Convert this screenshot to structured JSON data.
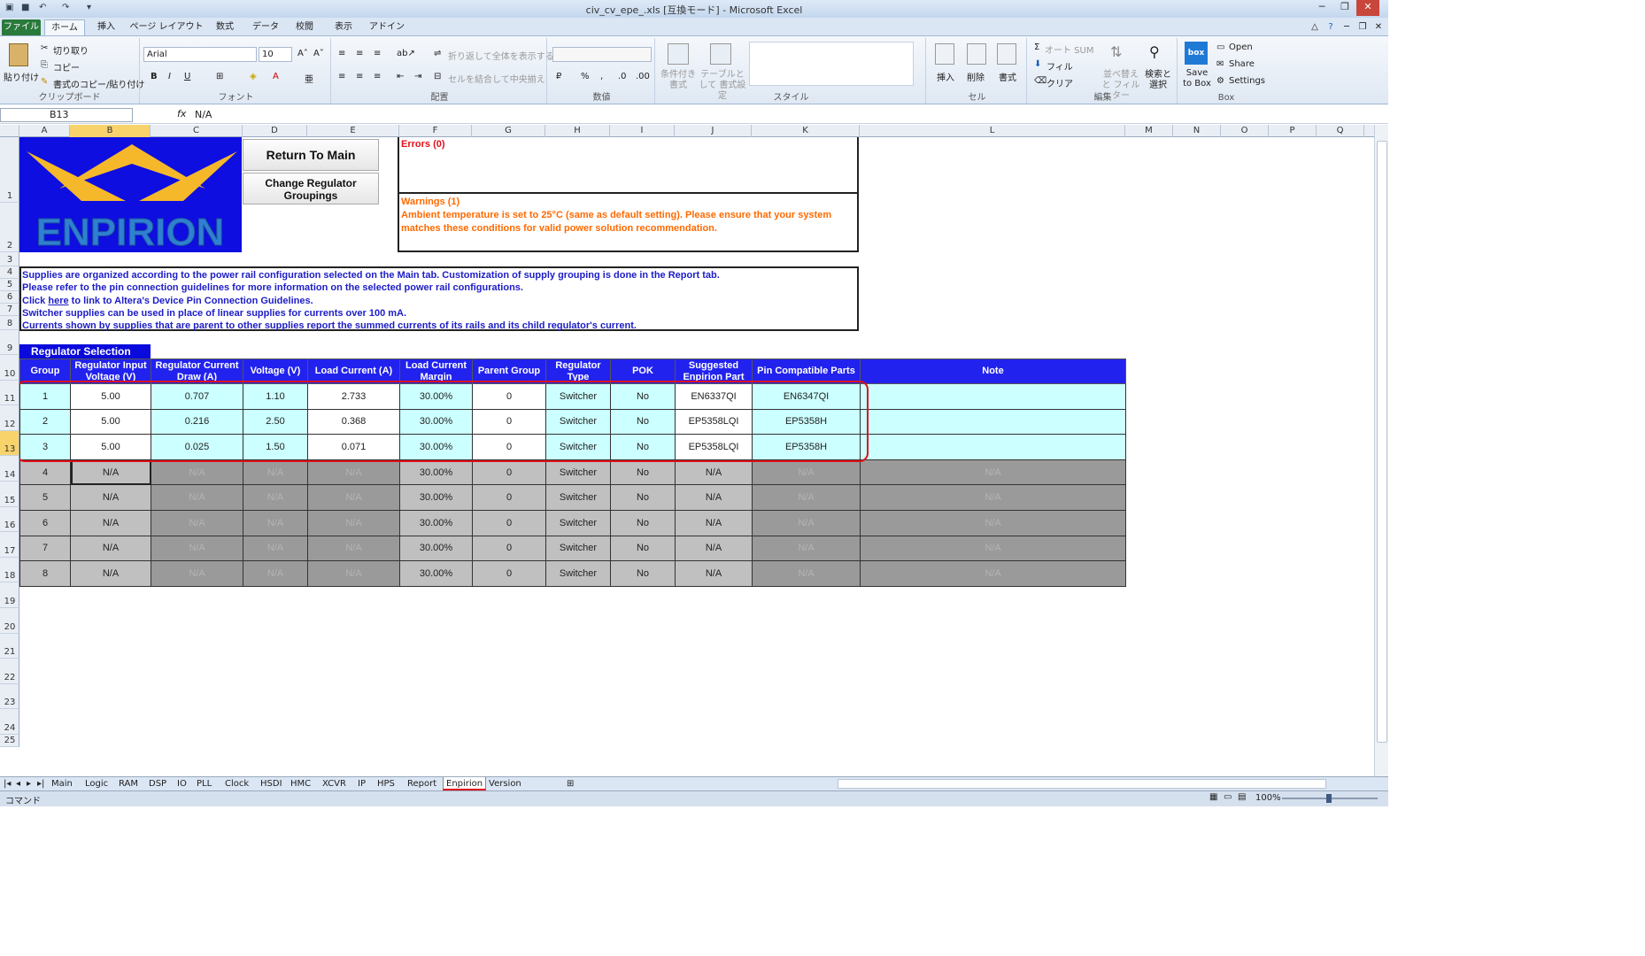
{
  "window": {
    "title": "civ_cv_epe_.xls [互換モード] - Microsoft Excel"
  },
  "ribbon_tabs": [
    "ファイル",
    "ホーム",
    "挿入",
    "ページ レイアウト",
    "数式",
    "データ",
    "校閲",
    "表示",
    "アドイン"
  ],
  "clipboard": {
    "paste": "貼り付け",
    "cut": "切り取り",
    "copy": "コピー",
    "format_painter": "書式のコピー/貼り付け",
    "label": "クリップボード"
  },
  "font": {
    "name": "Arial",
    "size": "10",
    "label": "フォント",
    "bold": "B",
    "italic": "I",
    "underline": "U"
  },
  "alignment": {
    "wrap": "折り返して全体を表示する",
    "merge": "セルを結合して中央揃え",
    "label": "配置"
  },
  "number": {
    "label": "数値",
    "percent": "%",
    "comma": ","
  },
  "styles": {
    "conditional": "条件付き 書式",
    "table": "テーブルとして 書式設定",
    "label": "スタイル"
  },
  "cells": {
    "insert": "挿入",
    "delete": "削除",
    "format": "書式",
    "label": "セル"
  },
  "editing": {
    "autosum": "オート SUM",
    "fill": "フィル",
    "clear": "クリア",
    "sort": "並べ替えと フィルター",
    "find": "検索と 選択",
    "label": "編集"
  },
  "box": {
    "save": "Save to Box",
    "open": "Open",
    "share": "Share",
    "settings": "Settings",
    "label": "Box",
    "icon_text": "box"
  },
  "formula_bar": {
    "name_box": "B13",
    "fx": "fx",
    "value": "N/A"
  },
  "columns": [
    {
      "id": "A",
      "w": 57
    },
    {
      "id": "B",
      "w": 91
    },
    {
      "id": "C",
      "w": 104
    },
    {
      "id": "D",
      "w": 73
    },
    {
      "id": "E",
      "w": 104
    },
    {
      "id": "F",
      "w": 82
    },
    {
      "id": "G",
      "w": 83
    },
    {
      "id": "H",
      "w": 73
    },
    {
      "id": "I",
      "w": 73
    },
    {
      "id": "J",
      "w": 87
    },
    {
      "id": "K",
      "w": 122
    },
    {
      "id": "L",
      "w": 300
    },
    {
      "id": "M",
      "w": 54
    },
    {
      "id": "N",
      "w": 54
    },
    {
      "id": "O",
      "w": 54
    },
    {
      "id": "P",
      "w": 54
    },
    {
      "id": "Q",
      "w": 54
    }
  ],
  "rows": [
    {
      "n": "1",
      "h": 74
    },
    {
      "n": "2",
      "h": 56
    },
    {
      "n": "3",
      "h": 16
    },
    {
      "n": "4",
      "h": 14
    },
    {
      "n": "5",
      "h": 14
    },
    {
      "n": "6",
      "h": 14
    },
    {
      "n": "7",
      "h": 14
    },
    {
      "n": "8",
      "h": 16
    },
    {
      "n": "9",
      "h": 28
    },
    {
      "n": "10",
      "h": 28.6
    },
    {
      "n": "11",
      "h": 28.6
    },
    {
      "n": "12",
      "h": 28.6
    },
    {
      "n": "13",
      "h": 28.6
    },
    {
      "n": "14",
      "h": 28.6
    },
    {
      "n": "15",
      "h": 28.6
    },
    {
      "n": "16",
      "h": 28.6
    },
    {
      "n": "17",
      "h": 28.6
    },
    {
      "n": "18",
      "h": 28.6
    },
    {
      "n": "19",
      "h": 28.6
    },
    {
      "n": "20",
      "h": 28.6
    },
    {
      "n": "21",
      "h": 28.6
    },
    {
      "n": "22",
      "h": 28.6
    },
    {
      "n": "23",
      "h": 28.6
    },
    {
      "n": "24",
      "h": 28.6
    },
    {
      "n": "25",
      "h": 14
    }
  ],
  "logo": {
    "text": "ENPIRION"
  },
  "buttons": {
    "return": "Return To Main",
    "change": "Change Regulator Groupings"
  },
  "errors": {
    "title": "Errors (0)"
  },
  "warnings": {
    "title": "Warnings (1)",
    "line1": "Ambient temperature is set to 25°C (same as default setting).  Please ensure that your system",
    "line2": "matches these conditions for valid power solution recommendation."
  },
  "info": {
    "l1": "Supplies are organized according to the power rail configuration selected on the Main tab. Customization of supply grouping is done in the Report tab.",
    "l2": "Please refer to the pin connection guidelines for more information on the selected power rail configurations.",
    "l3a": "Click ",
    "l3link": "here",
    "l3b": " to link to Altera's Device Pin Connection Guidelines.",
    "l4": "Switcher supplies can be used in place of linear supplies for currents over 100 mA.",
    "l5": "Currents shown by supplies that are parent to other supplies report the summed currents of its rails and its child regulator's current."
  },
  "regulator": {
    "title": "Regulator Selection",
    "headers": [
      "Group",
      "Regulator Input Voltage (V)",
      "Regulator Current Draw (A)",
      "Voltage (V)",
      "Load Current (A)",
      "Load Current Margin",
      "Parent Group",
      "Regulator Type",
      "POK",
      "Suggested Enpirion Part",
      "Pin Compatible Parts",
      "Note"
    ],
    "rows": [
      [
        "1",
        "5.00",
        "0.707",
        "1.10",
        "2.733",
        "30.00%",
        "0",
        "Switcher",
        "No",
        "EN6337QI",
        "EN6347QI",
        ""
      ],
      [
        "2",
        "5.00",
        "0.216",
        "2.50",
        "0.368",
        "30.00%",
        "0",
        "Switcher",
        "No",
        "EP5358LQI",
        "EP5358H",
        ""
      ],
      [
        "3",
        "5.00",
        "0.025",
        "1.50",
        "0.071",
        "30.00%",
        "0",
        "Switcher",
        "No",
        "EP5358LQI",
        "EP5358H",
        ""
      ],
      [
        "4",
        "N/A",
        "N/A",
        "N/A",
        "N/A",
        "30.00%",
        "0",
        "Switcher",
        "No",
        "N/A",
        "N/A",
        "N/A"
      ],
      [
        "5",
        "N/A",
        "N/A",
        "N/A",
        "N/A",
        "30.00%",
        "0",
        "Switcher",
        "No",
        "N/A",
        "N/A",
        "N/A"
      ],
      [
        "6",
        "N/A",
        "N/A",
        "N/A",
        "N/A",
        "30.00%",
        "0",
        "Switcher",
        "No",
        "N/A",
        "N/A",
        "N/A"
      ],
      [
        "7",
        "N/A",
        "N/A",
        "N/A",
        "N/A",
        "30.00%",
        "0",
        "Switcher",
        "No",
        "N/A",
        "N/A",
        "N/A"
      ],
      [
        "8",
        "N/A",
        "N/A",
        "N/A",
        "N/A",
        "30.00%",
        "0",
        "Switcher",
        "No",
        "N/A",
        "N/A",
        "N/A"
      ]
    ]
  },
  "sheet_tabs": [
    "Main",
    "Logic",
    "RAM",
    "DSP",
    "IO",
    "PLL",
    "Clock",
    "HSDI",
    "HMC",
    "XCVR",
    "IP",
    "HPS",
    "Report",
    "Enpirion",
    "Version"
  ],
  "active_sheet": "Enpirion",
  "status": {
    "mode": "コマンド",
    "zoom": "100%"
  },
  "colors": {
    "header_blue": "#2222ee",
    "cyan": "#ccffff",
    "gray": "#9a9a9a",
    "highlight_red": "#e0101a",
    "selected": "#f8d36c"
  }
}
